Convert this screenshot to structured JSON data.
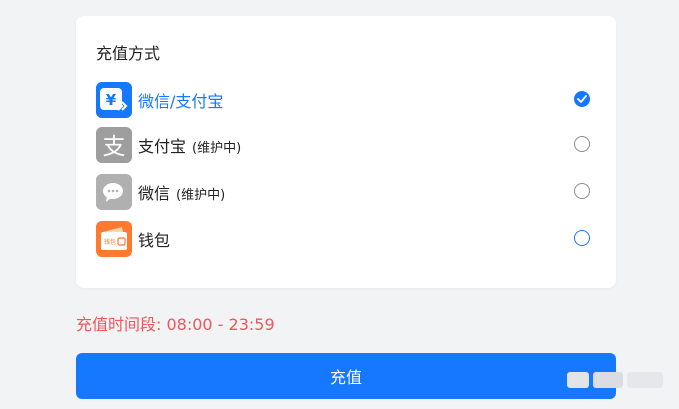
{
  "card": {
    "title": "充值方式"
  },
  "methods": [
    {
      "label": "微信/支付宝",
      "note": "",
      "icon": "wechat-alipay-icon",
      "icon_symbol": "¥",
      "selected": true
    },
    {
      "label": "支付宝",
      "note": "(维护中)",
      "icon": "alipay-icon",
      "icon_symbol": "支",
      "selected": false
    },
    {
      "label": "微信",
      "note": "(维护中)",
      "icon": "wechat-icon",
      "icon_symbol": "",
      "selected": false
    },
    {
      "label": "钱包",
      "note": "",
      "icon": "wallet-icon",
      "icon_symbol": "钱包",
      "selected": false
    }
  ],
  "time_note": "充值时间段: 08:00 - 23:59",
  "button": {
    "label": "充值"
  },
  "colors": {
    "accent": "#1677ff",
    "warning_text": "#f0565b",
    "disabled_icon": "#9e9e9e",
    "wallet_icon": "#ff7a2e"
  }
}
